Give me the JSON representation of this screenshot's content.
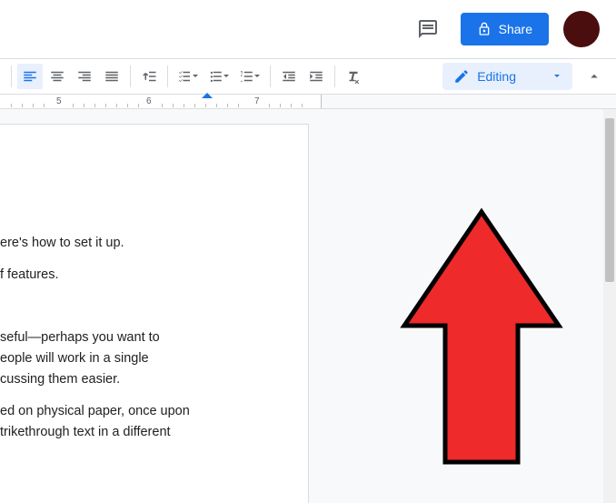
{
  "topbar": {
    "share_label": "Share"
  },
  "toolbar": {
    "editing_label": "Editing"
  },
  "ruler": {
    "num5": "5",
    "num6": "6",
    "num7": "7"
  },
  "doc": {
    "p1": "ere's how to set it up.",
    "p2": "f features.",
    "p3a": "seful—perhaps you want to",
    "p3b": "eople will work in a single",
    "p3c": "cussing them easier.",
    "p4a": "ed on physical paper, once upon",
    "p4b": "trikethrough text in a different"
  }
}
